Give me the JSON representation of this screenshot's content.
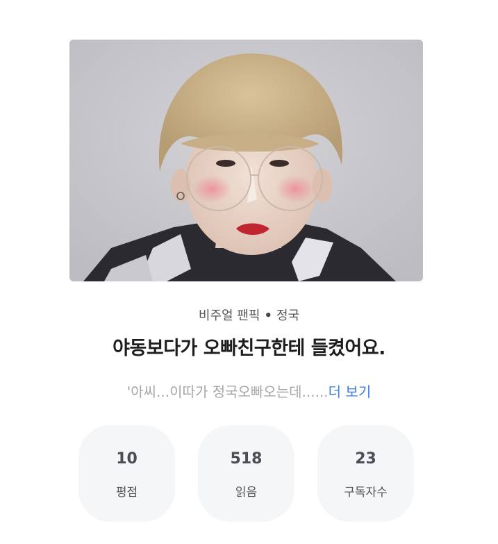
{
  "cover": {
    "icon": "cover-photo"
  },
  "category": {
    "genre": "비주얼 팬픽",
    "separator": "•",
    "member": "정국"
  },
  "title": "야동보다가 오빠친구한테 들켰어요.",
  "excerpt": {
    "text": "'아씨...이따가 정국오빠오는데......",
    "more_label": "더 보기"
  },
  "stats": [
    {
      "value": "10",
      "label": "평점"
    },
    {
      "value": "518",
      "label": "읽음"
    },
    {
      "value": "23",
      "label": "구독자수"
    }
  ],
  "colors": {
    "link": "#3f7fe6",
    "stat_bg": "#f5f6f8",
    "muted_text": "#a6a6aa"
  }
}
